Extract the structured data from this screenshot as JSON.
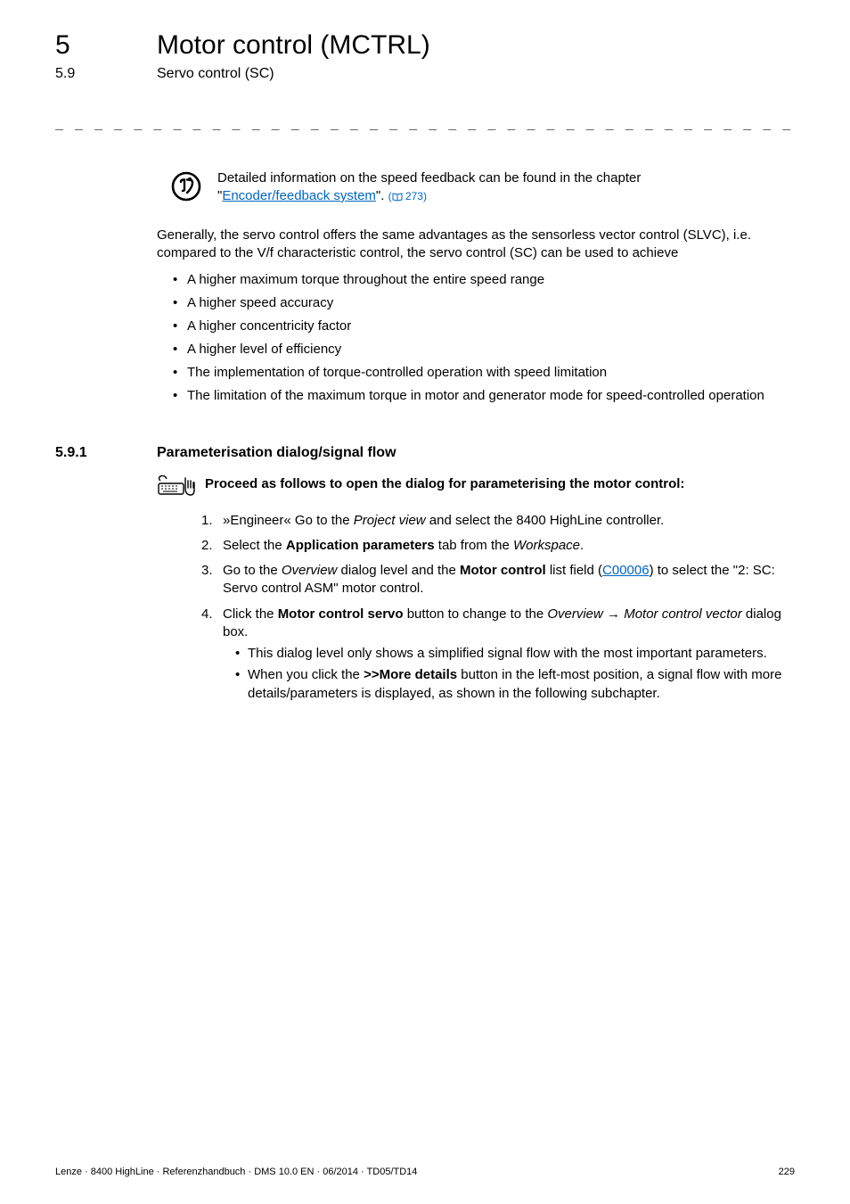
{
  "header": {
    "chapter_num": "5",
    "chapter_title": "Motor control (MCTRL)",
    "section_num": "5.9",
    "section_title": "Servo control (SC)"
  },
  "rule": "_ _ _ _ _ _ _ _ _ _ _ _ _ _ _ _ _ _ _ _ _ _ _ _ _ _ _ _ _ _ _ _ _ _ _ _ _ _ _ _ _ _ _ _ _ _ _ _ _ _ _ _ _ _ _ _ _ _ _ _ _ _ _ _",
  "tip": {
    "line1": "Detailed information on the speed feedback can be found in the chapter",
    "link_text": "Encoder/feedback system",
    "after_link": "\". ",
    "page_ref": "273)"
  },
  "intro": "Generally, the servo control offers the same advantages as the sensorless vector control (SLVC), i.e. compared to the V/f characteristic control, the servo control (SC) can be used to achieve",
  "bullets": [
    "A higher maximum torque throughout the entire speed range",
    "A higher speed accuracy",
    "A higher concentricity factor",
    "A higher level of efficiency",
    "The implementation of torque-controlled operation with speed limitation",
    "The limitation of the maximum torque in motor and generator mode for speed-controlled operation"
  ],
  "subsection": {
    "num": "5.9.1",
    "title": "Parameterisation dialog/signal flow"
  },
  "proceed": {
    "heading": "Proceed as follows to open the dialog for parameterising the motor control:",
    "steps": {
      "s1_a": "»Engineer« Go to the ",
      "s1_it": "Project view",
      "s1_b": " and select the 8400 HighLine controller.",
      "s2_a": "Select the ",
      "s2_bold": "Application parameters",
      "s2_b": " tab from the ",
      "s2_it": "Workspace",
      "s2_c": ".",
      "s3_a": "Go to the ",
      "s3_it1": "Overview",
      "s3_b": " dialog level and the ",
      "s3_bold": "Motor control",
      "s3_c": " list field (",
      "s3_link": "C00006",
      "s3_d": ") to select the \"2: SC: Servo control ASM\" motor control.",
      "s4_a": "Click the ",
      "s4_bold": "Motor control servo",
      "s4_b": " button to change to the ",
      "s4_it1": "Overview",
      "s4_arrow": " ",
      "s4_it2": "Motor control vector",
      "s4_c": " dialog box.",
      "s4_sub1": "This dialog level only shows a simplified signal flow with the most important parameters.",
      "s4_sub2a": "When you click the ",
      "s4_sub2bold": ">>More details",
      "s4_sub2b": " button in the left-most position, a signal flow with more details/parameters is displayed, as shown in the following subchapter."
    }
  },
  "footer": {
    "left": "Lenze · 8400 HighLine · Referenzhandbuch · DMS 10.0 EN · 06/2014 · TD05/TD14",
    "right": "229"
  }
}
